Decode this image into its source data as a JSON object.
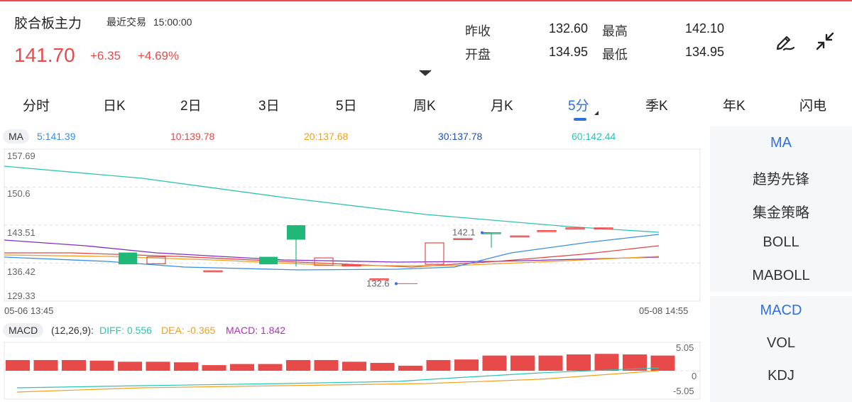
{
  "header": {
    "title": "胶合板主力",
    "session_label": "最近交易",
    "session_time": "15:00:00",
    "last_price": "141.70",
    "change": "+6.35",
    "change_pct": "+4.69%",
    "stats": {
      "prev_close_label": "昨收",
      "prev_close": "132.60",
      "high_label": "最高",
      "high": "142.10",
      "open_label": "开盘",
      "open": "134.95",
      "low_label": "最低",
      "low": "134.95"
    },
    "icons": {
      "draw": "pen-draw-icon",
      "collapse": "collapse-arrows-icon",
      "caret": "chevron-down-icon"
    }
  },
  "tabs": [
    {
      "label": "分时"
    },
    {
      "label": "日K"
    },
    {
      "label": "2日"
    },
    {
      "label": "3日"
    },
    {
      "label": "5日"
    },
    {
      "label": "周K"
    },
    {
      "label": "月K"
    },
    {
      "label": "5分",
      "active": true
    },
    {
      "label": "季K"
    },
    {
      "label": "年K"
    },
    {
      "label": "闪电"
    }
  ],
  "indicator": {
    "ma_badge": "MA",
    "ma_values": [
      {
        "text": "5:141.39",
        "color": "#3a8ee0"
      },
      {
        "text": "10:139.78",
        "color": "#e04a4a"
      },
      {
        "text": "20:137.68",
        "color": "#f0a020"
      },
      {
        "text": "30:137.78",
        "color": "#2050c0"
      },
      {
        "text": "60:142.44",
        "color": "#2ec4b0"
      }
    ],
    "macd_badge": "MACD",
    "macd_params": "(12,26,9):",
    "diff": "DIFF: 0.556",
    "dea": "DEA: -0.365",
    "macd": "MACD: 1.842"
  },
  "axis": {
    "price_ticks": [
      "157.69",
      "150.6",
      "143.51",
      "136.42",
      "129.33"
    ],
    "macd_ticks": [
      "5.05",
      "0",
      "-5.05"
    ],
    "time_start": "05-06 13:45",
    "time_end": "05-08 14:55"
  },
  "chart_data": {
    "type": "candlestick",
    "annotations": [
      {
        "label": "142.1",
        "kind": "max"
      },
      {
        "label": "132.6",
        "kind": "min"
      }
    ],
    "ylim": [
      129.33,
      157.69
    ],
    "candles": [
      {
        "open": 138.4,
        "close": 136.2,
        "high": 138.4,
        "low": 136.2
      },
      {
        "open": 137.6,
        "close": 136.3,
        "high": 137.6,
        "low": 136.3
      },
      {
        "open": 135.0,
        "close": 135.0,
        "high": 135.0,
        "low": 135.0
      },
      {
        "open": 137.6,
        "close": 136.2,
        "high": 137.6,
        "low": 136.2
      },
      {
        "open": 143.5,
        "close": 140.8,
        "high": 143.5,
        "low": 135.8
      },
      {
        "open": 137.4,
        "close": 136.0,
        "high": 137.4,
        "low": 136.0
      },
      {
        "open": 136.1,
        "close": 136.1,
        "high": 136.1,
        "low": 136.1
      },
      {
        "open": 133.5,
        "close": 133.5,
        "high": 133.5,
        "low": 133.5
      },
      {
        "open": 140.2,
        "close": 136.2,
        "high": 140.2,
        "low": 136.2
      },
      {
        "open": 141.0,
        "close": 141.0,
        "high": 141.0,
        "low": 141.0
      },
      {
        "open": 142.1,
        "close": 142.1,
        "high": 142.1,
        "low": 139.3
      },
      {
        "open": 141.5,
        "close": 141.5,
        "high": 141.5,
        "low": 141.5
      },
      {
        "open": 142.5,
        "close": 142.5,
        "high": 142.5,
        "low": 142.5
      },
      {
        "open": 143.0,
        "close": 143.0,
        "high": 143.0,
        "low": 143.0
      },
      {
        "open": 143.0,
        "close": 143.0,
        "high": 143.0,
        "low": 143.0
      }
    ],
    "macd_hist": [
      1.9,
      1.9,
      1.9,
      1.8,
      1.6,
      1.6,
      1.5,
      1.0,
      1.2,
      1.2,
      1.9,
      1.9,
      1.6,
      1.4,
      0.9,
      1.9,
      2.0,
      2.7,
      2.7,
      2.7,
      2.9,
      3.0,
      2.9,
      2.7
    ],
    "macd_ylim": [
      -5.05,
      5.05
    ]
  },
  "side_panel": {
    "main_indicators": [
      {
        "label": "MA",
        "active": true
      },
      {
        "label": "趋势先锋"
      },
      {
        "label": "集金策略"
      },
      {
        "label": "BOLL"
      },
      {
        "label": "MABOLL"
      }
    ],
    "sub_indicators": [
      {
        "label": "MACD",
        "active": true
      },
      {
        "label": "VOL"
      },
      {
        "label": "KDJ"
      }
    ]
  }
}
